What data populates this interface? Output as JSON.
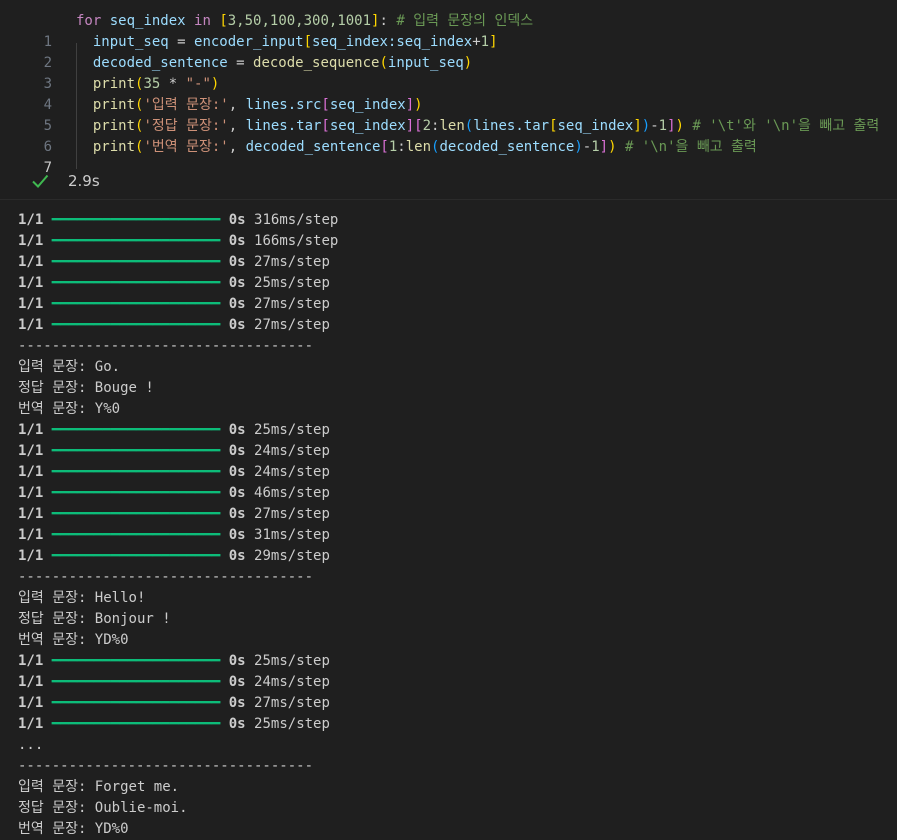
{
  "cell": {
    "line_numbers": [
      "1",
      "2",
      "3",
      "4",
      "5",
      "6",
      "7"
    ],
    "code": {
      "l1": {
        "kw_for": "for",
        "v_seq_index": " seq_index ",
        "kw_in": "in",
        "sp": " ",
        "b1": "[",
        "nums": "3,50,100,300,1001",
        "b2": "]",
        "colon": ": ",
        "comment": "# 입력 문장의 인덱스"
      },
      "l2": {
        "lhs": "input_seq",
        "eq": " = ",
        "v1": "encoder_input",
        "b1": "[",
        "v2": "seq_index:seq_index",
        "plus": "+",
        "n1": "1",
        "b2": "]"
      },
      "l3": {
        "lhs": "decoded_sentence",
        "eq": " = ",
        "fn": "decode_sequence",
        "p1": "(",
        "arg": "input_seq",
        "p2": ")"
      },
      "l4": {
        "fn": "print",
        "p1": "(",
        "n1": "35",
        "op": " * ",
        "str": "\"-\"",
        "p2": ")"
      },
      "l5": {
        "fn": "print",
        "p1": "(",
        "str": "'입력 문장:'",
        "comma": ", ",
        "v1": "lines.src",
        "b1": "[",
        "v2": "seq_index",
        "b2": "]",
        "p2": ")"
      },
      "l6": {
        "fn": "print",
        "p1": "(",
        "str": "'정답 문장:'",
        "comma": ", ",
        "v1": "lines.tar",
        "b1": "[",
        "v2": "seq_index",
        "b2": "]",
        "b3": "[",
        "n1": "2",
        "colon": ":",
        "fn2": "len",
        "p3": "(",
        "v3": "lines.tar",
        "b4": "[",
        "v4": "seq_index",
        "b5": "]",
        "p4": ")",
        "minus": "-",
        "n2": "1",
        "b6": "]",
        "p2": ")",
        "comment": " # '\\t'와 '\\n'을 빼고 출력"
      },
      "l7": {
        "fn": "print",
        "p1": "(",
        "str": "'번역 문장:'",
        "comma": ", ",
        "v1": "decoded_sentence",
        "b1": "[",
        "n1": "1",
        "colon": ":",
        "fn2": "len",
        "p3": "(",
        "v2": "decoded_sentence",
        "p4": ")",
        "minus": "-",
        "n2": "1",
        "b2": "]",
        "p2": ")",
        "comment": " # '\\n'을 빼고 출력"
      }
    },
    "status": {
      "time": "2.9s"
    }
  },
  "output": {
    "bar": "━━━━━━━━━━━━━━━━━━━━",
    "progress_fraction": 1.0,
    "lines": [
      {
        "type": "progress",
        "count": "1/1",
        "time": "0s",
        "rate": "316ms/step"
      },
      {
        "type": "progress",
        "count": "1/1",
        "time": "0s",
        "rate": "166ms/step"
      },
      {
        "type": "progress",
        "count": "1/1",
        "time": "0s",
        "rate": "27ms/step"
      },
      {
        "type": "progress",
        "count": "1/1",
        "time": "0s",
        "rate": "25ms/step"
      },
      {
        "type": "progress",
        "count": "1/1",
        "time": "0s",
        "rate": "27ms/step"
      },
      {
        "type": "progress",
        "count": "1/1",
        "time": "0s",
        "rate": "27ms/step"
      },
      {
        "type": "text",
        "text": "-----------------------------------"
      },
      {
        "type": "text",
        "text": "입력 문장: Go."
      },
      {
        "type": "text",
        "text": "정답 문장: Bouge !"
      },
      {
        "type": "text",
        "text": "번역 문장: Y%0"
      },
      {
        "type": "progress",
        "count": "1/1",
        "time": "0s",
        "rate": "25ms/step"
      },
      {
        "type": "progress",
        "count": "1/1",
        "time": "0s",
        "rate": "24ms/step"
      },
      {
        "type": "progress",
        "count": "1/1",
        "time": "0s",
        "rate": "24ms/step"
      },
      {
        "type": "progress",
        "count": "1/1",
        "time": "0s",
        "rate": "46ms/step"
      },
      {
        "type": "progress",
        "count": "1/1",
        "time": "0s",
        "rate": "27ms/step"
      },
      {
        "type": "progress",
        "count": "1/1",
        "time": "0s",
        "rate": "31ms/step"
      },
      {
        "type": "progress",
        "count": "1/1",
        "time": "0s",
        "rate": "29ms/step"
      },
      {
        "type": "text",
        "text": "-----------------------------------"
      },
      {
        "type": "text",
        "text": "입력 문장: Hello!"
      },
      {
        "type": "text",
        "text": "정답 문장: Bonjour !"
      },
      {
        "type": "text",
        "text": "번역 문장: YD%0"
      },
      {
        "type": "progress",
        "count": "1/1",
        "time": "0s",
        "rate": "25ms/step"
      },
      {
        "type": "progress",
        "count": "1/1",
        "time": "0s",
        "rate": "24ms/step"
      },
      {
        "type": "progress",
        "count": "1/1",
        "time": "0s",
        "rate": "27ms/step"
      },
      {
        "type": "progress",
        "count": "1/1",
        "time": "0s",
        "rate": "25ms/step"
      },
      {
        "type": "text",
        "text": "..."
      },
      {
        "type": "text",
        "text": "-----------------------------------"
      },
      {
        "type": "text",
        "text": "입력 문장: Forget me."
      },
      {
        "type": "text",
        "text": "정답 문장: Oublie-moi."
      },
      {
        "type": "text",
        "text": "번역 문장: YD%0"
      }
    ]
  },
  "colors": {
    "background": "#1f1f1f",
    "success_check": "#3fb950",
    "progress_bar": "#0dbc79"
  }
}
